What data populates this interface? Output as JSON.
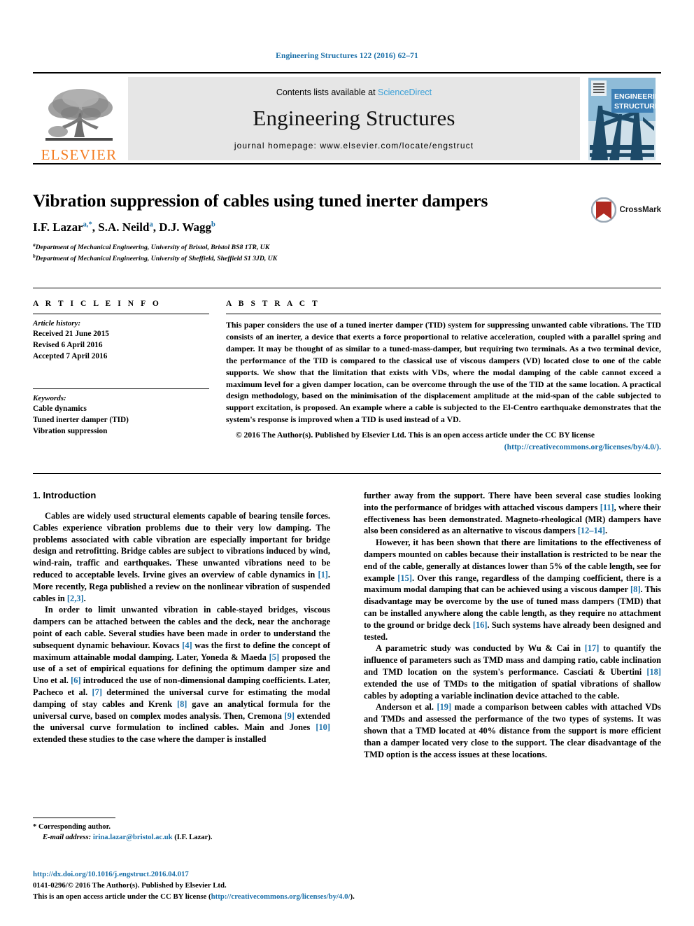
{
  "running_head": "Engineering Structures 122 (2016) 62–71",
  "masthead": {
    "publisher_name": "ELSEVIER",
    "contents_prefix": "Contents lists available at ",
    "sciencedirect": "ScienceDirect",
    "journal_title": "Engineering Structures",
    "homepage": "journal homepage: www.elsevier.com/locate/engstruct",
    "cover_line1": "ENGINEERING",
    "cover_line2": "STRUCTURES"
  },
  "article": {
    "title": "Vibration suppression of cables using tuned inerter dampers",
    "authors": [
      {
        "name": "I.F. Lazar",
        "sup": "a,*"
      },
      {
        "name": "S.A. Neild",
        "sup": "a"
      },
      {
        "name": "D.J. Wagg",
        "sup": "b"
      }
    ],
    "affiliations": [
      {
        "mark": "a",
        "text": "Department of Mechanical Engineering, University of Bristol, Bristol BS8 1TR, UK"
      },
      {
        "mark": "b",
        "text": "Department of Mechanical Engineering, University of Sheffield, Sheffield S1 3JD, UK"
      }
    ],
    "crossmark_label": "CrossMark"
  },
  "info": {
    "heading": "A R T I C L E  I N F O",
    "history_label": "Article history:",
    "history": [
      "Received 21 June 2015",
      "Revised 6 April 2016",
      "Accepted 7 April 2016"
    ],
    "keywords_label": "Keywords:",
    "keywords": [
      "Cable dynamics",
      "Tuned inerter damper (TID)",
      "Vibration suppression"
    ]
  },
  "abstract": {
    "heading": "A B S T R A C T",
    "text": "This paper considers the use of a tuned inerter damper (TID) system for suppressing unwanted cable vibrations. The TID consists of an inerter, a device that exerts a force proportional to relative acceleration, coupled with a parallel spring and damper. It may be thought of as similar to a tuned-mass-damper, but requiring two terminals. As a two terminal device, the performance of the TID is compared to the classical use of viscous dampers (VD) located close to one of the cable supports. We show that the limitation that exists with VDs, where the modal damping of the cable cannot exceed a maximum level for a given damper location, can be overcome through the use of the TID at the same location. A practical design methodology, based on the minimisation of the displacement amplitude at the mid-span of the cable subjected to support excitation, is proposed. An example where a cable is subjected to the El-Centro earthquake demonstrates that the system's response is improved when a TID is used instead of a VD.",
    "copyright_text": "© 2016 The Author(s). Published by Elsevier Ltd. This is an open access article under the CC BY license",
    "license_url": "(http://creativecommons.org/licenses/by/4.0/)."
  },
  "body": {
    "section_heading": "1. Introduction",
    "left_paragraphs": [
      "Cables are widely used structural elements capable of bearing tensile forces. Cables experience vibration problems due to their very low damping. The problems associated with cable vibration are especially important for bridge design and retrofitting. Bridge cables are subject to vibrations induced by wind, wind-rain, traffic and earthquakes. These unwanted vibrations need to be reduced to acceptable levels. Irvine gives an overview of cable dynamics in [1]. More recently, Rega published a review on the nonlinear vibration of suspended cables in [2,3].",
      "In order to limit unwanted vibration in cable-stayed bridges, viscous dampers can be attached between the cables and the deck, near the anchorage point of each cable. Several studies have been made in order to understand the subsequent dynamic behaviour. Kovacs [4] was the first to define the concept of maximum attainable modal damping. Later, Yoneda & Maeda [5] proposed the use of a set of empirical equations for defining the optimum damper size and Uno et al. [6] introduced the use of non-dimensional damping coefficients. Later, Pacheco et al. [7] determined the universal curve for estimating the modal damping of stay cables and Krenk [8] gave an analytical formula for the universal curve, based on complex modes analysis. Then, Cremona [9] extended the universal curve formulation to inclined cables. Main and Jones [10] extended these studies to the case where the damper is installed"
    ],
    "right_paragraphs": [
      "further away from the support. There have been several case studies looking into the performance of bridges with attached viscous dampers [11], where their effectiveness has been demonstrated. Magneto-rheological (MR) dampers have also been considered as an alternative to viscous dampers [12–14].",
      "However, it has been shown that there are limitations to the effectiveness of dampers mounted on cables because their installation is restricted to be near the end of the cable, generally at distances lower than 5% of the cable length, see for example [15]. Over this range, regardless of the damping coefficient, there is a maximum modal damping that can be achieved using a viscous damper [8]. This disadvantage may be overcome by the use of tuned mass dampers (TMD) that can be installed anywhere along the cable length, as they require no attachment to the ground or bridge deck [16]. Such systems have already been designed and tested.",
      "A parametric study was conducted by Wu & Cai in [17] to quantify the influence of parameters such as TMD mass and damping ratio, cable inclination and TMD location on the system's performance. Casciati & Ubertini [18] extended the use of TMDs to the mitigation of spatial vibrations of shallow cables by adopting a variable inclination device attached to the cable.",
      "Anderson et al. [19] made a comparison between cables with attached VDs and TMDs and assessed the performance of the two types of systems. It was shown that a TMD located at 40% distance from the support is more efficient than a damper located very close to the support. The clear disadvantage of the TMD option is the access issues at these locations."
    ]
  },
  "footnote": {
    "corresponding_marker": "*",
    "corresponding_text": "Corresponding author.",
    "email_label": "E-mail address:",
    "email": "irina.lazar@bristol.ac.uk",
    "email_owner": "(I.F. Lazar)."
  },
  "page_footer": {
    "doi": "http://dx.doi.org/10.1016/j.engstruct.2016.04.017",
    "issn_line": "0141-0296/© 2016 The Author(s). Published by Elsevier Ltd.",
    "license_prefix": "This is an open access article under the CC BY license (",
    "license_url": "http://creativecommons.org/licenses/by/4.0/",
    "license_suffix": ")."
  },
  "colors": {
    "link_blue": "#1a6fa8",
    "sciencedirect_blue": "#3aa0d8",
    "elsevier_orange": "#F47B20",
    "crossmark_red": "#b02a21",
    "cover_blue": "#3d7fb5"
  }
}
